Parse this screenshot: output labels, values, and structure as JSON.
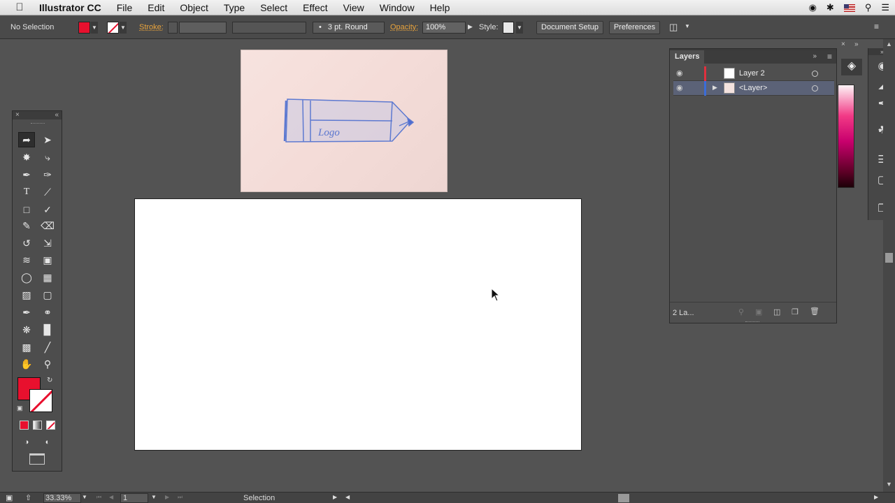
{
  "menubar": {
    "app_name": "Illustrator CC",
    "items": [
      "File",
      "Edit",
      "Object",
      "Type",
      "Select",
      "Effect",
      "View",
      "Window",
      "Help"
    ]
  },
  "controlbar": {
    "selection_label": "No Selection",
    "stroke_label": "Stroke:",
    "brush_value": "3 pt. Round",
    "opacity_label": "Opacity:",
    "opacity_value": "100%",
    "style_label": "Style:",
    "document_setup": "Document Setup",
    "preferences": "Preferences",
    "fill_color": "#e8102e"
  },
  "canvas": {
    "sketch_text": "Logo"
  },
  "layers_panel": {
    "title": "Layers",
    "rows": [
      {
        "name": "Layer 2",
        "color": "#e0303e",
        "selected": false
      },
      {
        "name": "<Layer>",
        "color": "#3b6cd8",
        "selected": true
      }
    ],
    "count_label": "2 La..."
  },
  "statusbar": {
    "zoom": "33.33%",
    "page": "1",
    "tool": "Selection"
  }
}
